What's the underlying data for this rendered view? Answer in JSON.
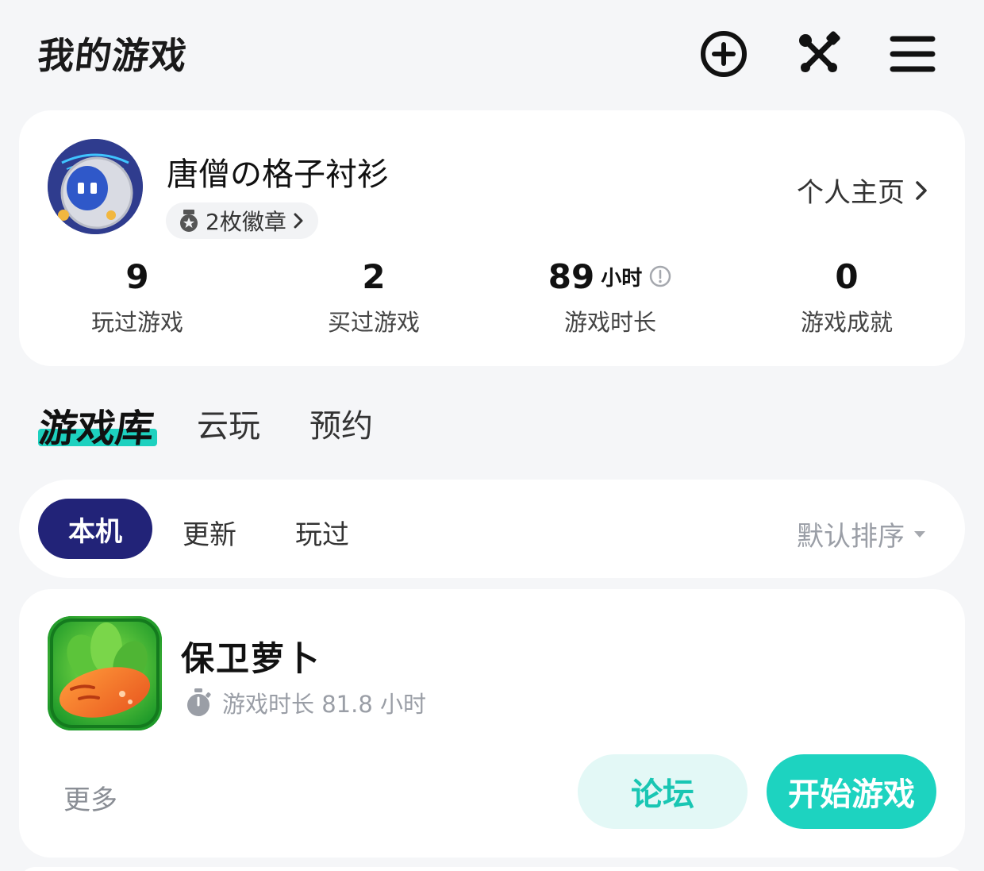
{
  "header": {
    "title": "我的游戏",
    "icons": [
      "add-circle-icon",
      "tools-icon",
      "menu-icon"
    ]
  },
  "profile": {
    "username": "唐僧の格子衬衫",
    "badge_label": "2枚徽章",
    "homepage_label": "个人主页",
    "stats": [
      {
        "value": "9",
        "unit": "",
        "label": "玩过游戏"
      },
      {
        "value": "2",
        "unit": "",
        "label": "买过游戏"
      },
      {
        "value": "89",
        "unit": "小时",
        "label": "游戏时长"
      },
      {
        "value": "0",
        "unit": "",
        "label": "游戏成就"
      }
    ]
  },
  "main_tabs": [
    {
      "label": "游戏库",
      "active": true
    },
    {
      "label": "云玩",
      "active": false
    },
    {
      "label": "预约",
      "active": false
    }
  ],
  "filters": {
    "tabs": [
      {
        "label": "本机",
        "active": true
      },
      {
        "label": "更新",
        "active": false
      },
      {
        "label": "玩过",
        "active": false
      }
    ],
    "sort_label": "默认排序"
  },
  "game": {
    "title": "保卫萝卜",
    "playtime_label": "游戏时长 81.8 小时",
    "more_label": "更多",
    "forum_label": "论坛",
    "play_label": "开始游戏"
  },
  "colors": {
    "accent": "#1dd3c0",
    "navy": "#222378",
    "forum_bg": "#e3f8f6",
    "background": "#f5f6f8"
  }
}
